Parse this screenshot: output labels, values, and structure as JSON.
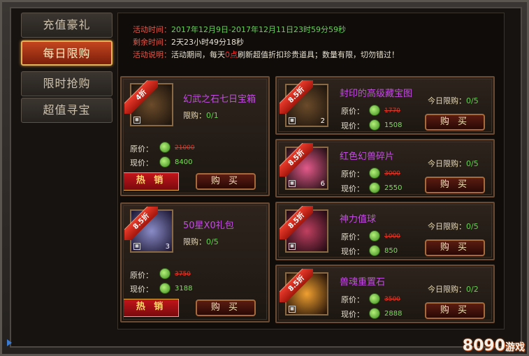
{
  "tabs": [
    {
      "label": "充值豪礼"
    },
    {
      "label": "每日限购"
    },
    {
      "label": "限时抢购"
    },
    {
      "label": "超值寻宝"
    }
  ],
  "info": {
    "time_label": "活动时间：",
    "time_value": "2017年12月9日-2017年12月11日23时59分59秒",
    "remain_label": "剩余时间：",
    "remain_value": "2天23小时49分18秒",
    "desc_label": "活动说明：",
    "desc_pre": "活动期间，每天",
    "desc_highlight": "0点",
    "desc_post": "刷新超值折扣珍贵道具；数量有限，切勿错过！"
  },
  "labels": {
    "orig": "原价：",
    "now": "现价：",
    "buy": "购 买",
    "hot": "热 销",
    "limit_prefix": "限购：",
    "daily_prefix": "今日限购："
  },
  "big_cards": [
    {
      "discount": "4折",
      "name": "幻武之石七日宝箱",
      "limit": "0/1",
      "orig": "21000",
      "now": "8400",
      "count": ""
    },
    {
      "discount": "8.5折",
      "name": "50星X0礼包",
      "limit": "0/5",
      "orig": "3750",
      "now": "3188",
      "count": "3"
    }
  ],
  "small_cards": [
    {
      "discount": "8.5折",
      "name": "封印的高级藏宝图",
      "limit": "0/5",
      "orig": "1770",
      "now": "1508",
      "count": "2"
    },
    {
      "discount": "8.5折",
      "name": "红色幻兽碎片",
      "limit": "0/5",
      "orig": "3000",
      "now": "2550",
      "count": "6"
    },
    {
      "discount": "8.5折",
      "name": "神力值球",
      "limit": "0/5",
      "orig": "1000",
      "now": "850",
      "count": ""
    },
    {
      "discount": "8.5折",
      "name": "兽魂重置石",
      "limit": "0/2",
      "orig": "3500",
      "now": "2888",
      "count": ""
    }
  ],
  "watermark": {
    "num": "8090",
    "brand": "游戏"
  }
}
